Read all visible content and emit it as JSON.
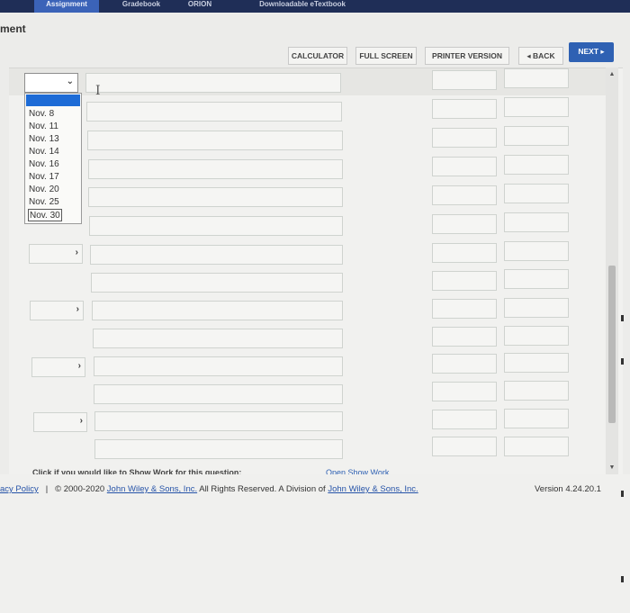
{
  "topnav": {
    "tabs": [
      {
        "label": "Assignment",
        "active": true
      },
      {
        "label": "Gradebook",
        "active": false
      },
      {
        "label": "ORION",
        "active": false
      },
      {
        "label": "Downloadable eTextbook",
        "active": false
      }
    ]
  },
  "page": {
    "heading": "ment"
  },
  "toolbar": {
    "calculator": "CALCULATOR",
    "full_screen": "FULL SCREEN",
    "printer_version": "PRINTER VERSION",
    "back": "◂ BACK",
    "next": "NEXT ▸"
  },
  "date_dropdown": {
    "selected": "",
    "options": [
      "Nov. 8",
      "Nov. 11",
      "Nov. 13",
      "Nov. 14",
      "Nov. 16",
      "Nov. 17",
      "Nov. 20",
      "Nov. 25",
      "Nov. 30"
    ]
  },
  "show_work": {
    "prompt": "Click if you would like to Show Work for this question:",
    "link": "Open Show Work"
  },
  "footer": {
    "privacy": "acy Policy",
    "separator": "|",
    "copyright_prefix": "© 2000-2020 ",
    "company": "John Wiley & Sons, Inc.",
    "rights": " All Rights Reserved. A Division of ",
    "company2": "John Wiley & Sons, Inc.",
    "version": "Version 4.24.20.1"
  },
  "colors": {
    "nav": "#1f2e57",
    "accent": "#2f61b3",
    "selection": "#1d6bd6"
  }
}
